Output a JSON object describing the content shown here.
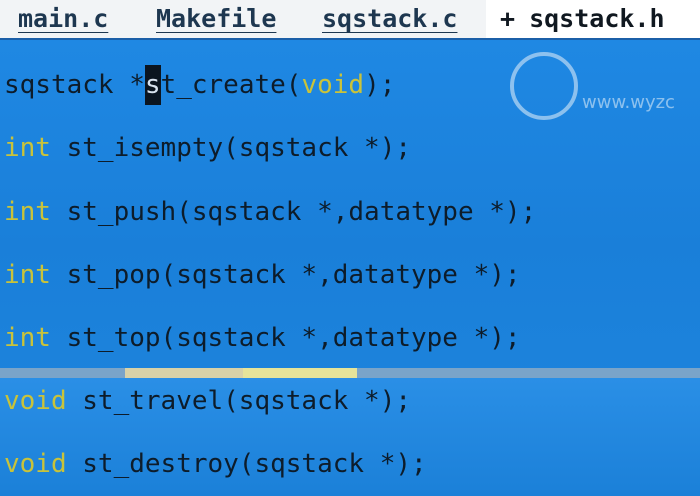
{
  "tabs": [
    {
      "label": "main.c",
      "active": false
    },
    {
      "label": "Makefile",
      "active": false
    },
    {
      "label": "sqstack.c",
      "active": false
    },
    {
      "label": "sqstack.h",
      "active": true,
      "modified_marker": "+"
    }
  ],
  "code": {
    "line1": {
      "type": "sqstack ",
      "star": "*",
      "cursor_char": "s",
      "rest": "t_create(",
      "param_kw": "void",
      "end": ");"
    },
    "line2": {
      "type": "int",
      "text": " st_isempty(sqstack *);"
    },
    "line3": {
      "type": "int",
      "text": " st_push(sqstack *,datatype *);"
    },
    "line4": {
      "type": "int",
      "text": " st_pop(sqstack *,datatype *);"
    },
    "line5": {
      "type": "int",
      "text": " st_top(sqstack *,datatype *);"
    },
    "line6": {
      "type": "void",
      "text": " st_travel(sqstack *);"
    },
    "line7": {
      "type": "void",
      "text": " st_destroy(sqstack *);"
    }
  },
  "watermark": {
    "text": "www.wyzc"
  },
  "colors": {
    "keyword": "#c9c33a",
    "editor_bg": "#1c7fd8",
    "text": "#0d1c2a"
  }
}
